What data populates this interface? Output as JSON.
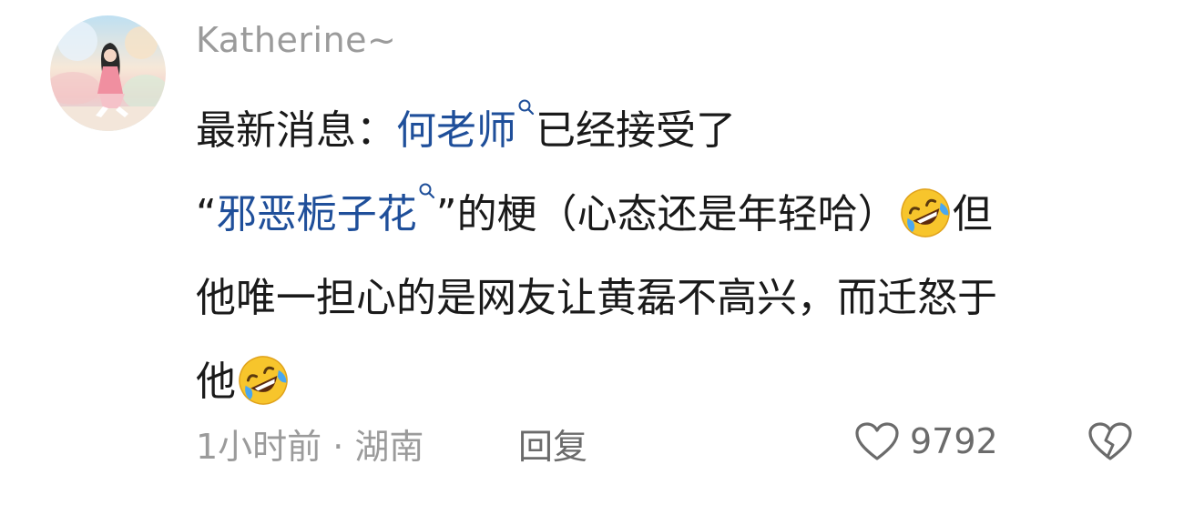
{
  "comment": {
    "author": "Katherine~",
    "segments": {
      "l1_a": "最新消息：",
      "l1_link": "何老师",
      "l1_b": "已经接受了",
      "l2_a": "“",
      "l2_link": "邪恶栀子花",
      "l2_b": "”的梗（心态还是年轻哈）",
      "l2_c": "但",
      "l3": "他唯一担心的是网友让黄磊不高兴，而迁怒于",
      "l4": "他"
    },
    "link_color": "#1f4f9a",
    "emoji": "rolling-on-the-floor-laughing"
  },
  "footer": {
    "time_location": "1小时前 · 湖南",
    "reply_label": "回复",
    "like_count": "9792"
  },
  "icons": {
    "like": "heart-outline-icon",
    "dislike": "broken-heart-icon",
    "search": "search-icon"
  }
}
